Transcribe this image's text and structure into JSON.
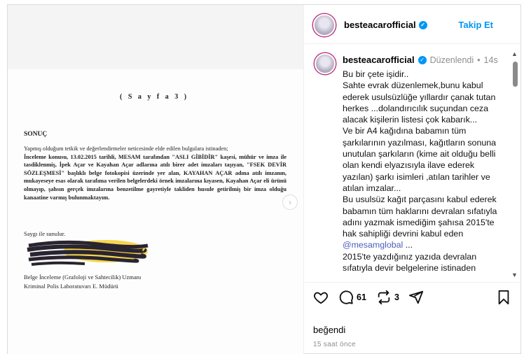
{
  "post": {
    "username": "besteacarofficial",
    "follow_label": "Takip Et",
    "edited_label": "Düzenlendi",
    "time_ago": "14s",
    "caption": "Bu bir çete işidir..\nSahte evrak düzenlemek,bunu kabul ederek usulsüzlüğe yıllardır çanak tutan herkes ...dolandırıcılık suçundan ceza alacak kişilerin listesi çok kabarık...\nVe bir A4 kağıdına babamın tüm şarkılarının yazılması, kağıtların sonuna unutulan şarkıların (kime ait olduğu belli olan kendi elyazısıyla ilave ederek yazılan) şarkı isimleri ,atılan tarihler ve atılan imzalar...\nBu usulsüz kağıt parçasını kabul ederek babamın tüm haklarını devralan sıfatıyla  adını yazmak ismediğim şahısa 2015'te  hak sahipliği devrini kabul eden ",
    "mention": "@mesamglobal",
    "caption_tail": " ...\n2015'te yazdığınız yazıda devralan sıfatıyla devir belgelerine istinaden",
    "comments_count": "61",
    "shares_count": "3",
    "likes_label": "beğendi",
    "posted_ago": "15 saat önce"
  },
  "document": {
    "page_label": "( S a y f a 3 )",
    "section_title": "SONUÇ",
    "para1": "Yapmış olduğum tetkik ve değerlendirmeler neticesinde elde edilen bulgulara istinaden;",
    "para2": "İnceleme konusu, 13.02.2015 tarihli, MESAM tarafından \"ASLI GİBİDİR\" kaşesi, mühür ve imza ile tasdiklenmiş, İpek Açar ve Kayahan Açar adlarına atılı birer adet imzaları taşıyan, \"FSEK DEVİR SÖZLEŞMESİ\" başlıklı belge fotokopisi üzerinde yer alan, KAYAHAN AÇAR adına atılı imzanın, mukayeseye esas olarak tarafıma verilen belgelerdeki örnek imzalarına kıyasen, Kayahan Açar eli ürünü olmayıp, şahsın gerçek imzalarına benzetilme gayretiyle takliden husule getirilmiş bir imza olduğu kanaatine varmış bulunmaktayım.",
    "closing": "Saygı ile sunulur.",
    "signer_title_1": "Belge İnceleme (Grafoloji ve Sahtecilik) Uzmanı",
    "signer_title_2": "Kriminal Polis Laboratuvarı E. Müdürü"
  },
  "colors": {
    "accent": "#0095f6",
    "mention": "#4a5dbd",
    "highlight": "#f4d23c"
  }
}
